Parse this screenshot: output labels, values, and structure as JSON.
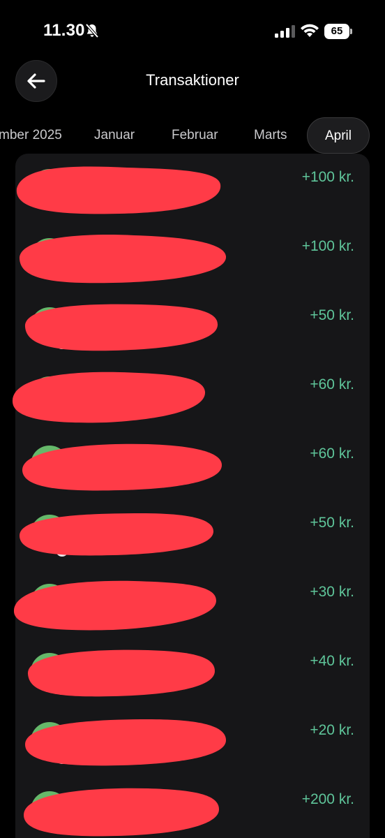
{
  "status_bar": {
    "time": "11.30",
    "battery": "65",
    "icons": [
      "bell-off-icon",
      "signal-icon",
      "wifi-icon",
      "battery-icon"
    ]
  },
  "header": {
    "title": "Transaktioner",
    "back_icon": "arrow-left-icon"
  },
  "tabs": [
    {
      "label": "mber 2025",
      "active": false
    },
    {
      "label": "Januar",
      "active": false
    },
    {
      "label": "Februar",
      "active": false
    },
    {
      "label": "Marts",
      "active": false
    },
    {
      "label": "April",
      "active": true
    }
  ],
  "transactions": [
    {
      "amount": "+100 kr."
    },
    {
      "amount": "+100 kr."
    },
    {
      "amount": "+50 kr."
    },
    {
      "amount": "+60 kr."
    },
    {
      "amount": "+60 kr."
    },
    {
      "amount": "+50 kr."
    },
    {
      "amount": "+30 kr."
    },
    {
      "amount": "+40 kr."
    },
    {
      "amount": "+20 kr."
    },
    {
      "amount": "+200 kr."
    }
  ],
  "colors": {
    "background": "#000000",
    "card": "#161618",
    "amount_positive": "#5fc59a",
    "avatar": "#66b86a",
    "redaction": "#ff3b47"
  }
}
